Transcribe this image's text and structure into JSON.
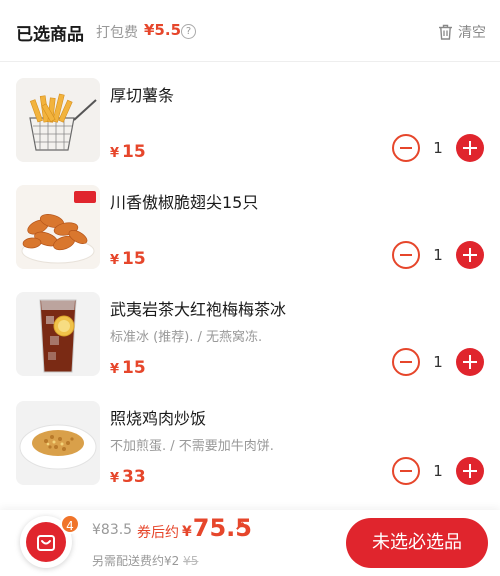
{
  "header": {
    "title": "已选商品",
    "pack_label": "打包费",
    "pack_price": "¥5.5",
    "help_glyph": "?",
    "clear_label": "清空"
  },
  "items": [
    {
      "name": "厚切薯条",
      "spec": "",
      "price": "15",
      "qty": "1"
    },
    {
      "name": "川香傲椒脆翅尖15只",
      "spec": "",
      "price": "15",
      "qty": "1"
    },
    {
      "name": "武夷岩茶大红袍梅梅茶冰",
      "spec": "标准冰 (推荐). / 无燕窝冻.",
      "price": "15",
      "qty": "1"
    },
    {
      "name": "照烧鸡肉炒饭",
      "spec": "不加煎蛋. / 不需要加牛肉饼.",
      "price": "33",
      "qty": "1"
    }
  ],
  "currency": "¥",
  "footer": {
    "cart_count": "4",
    "original_total": "¥83.5",
    "estimate_label": "券后约",
    "estimate_price": "75.5",
    "delivery_text": "另需配送费约¥2",
    "delivery_original": "¥5",
    "cta_label": "未选必选品"
  },
  "colors": {
    "accent": "#e0252d",
    "price": "#e6462b",
    "badge": "#f0742a"
  }
}
